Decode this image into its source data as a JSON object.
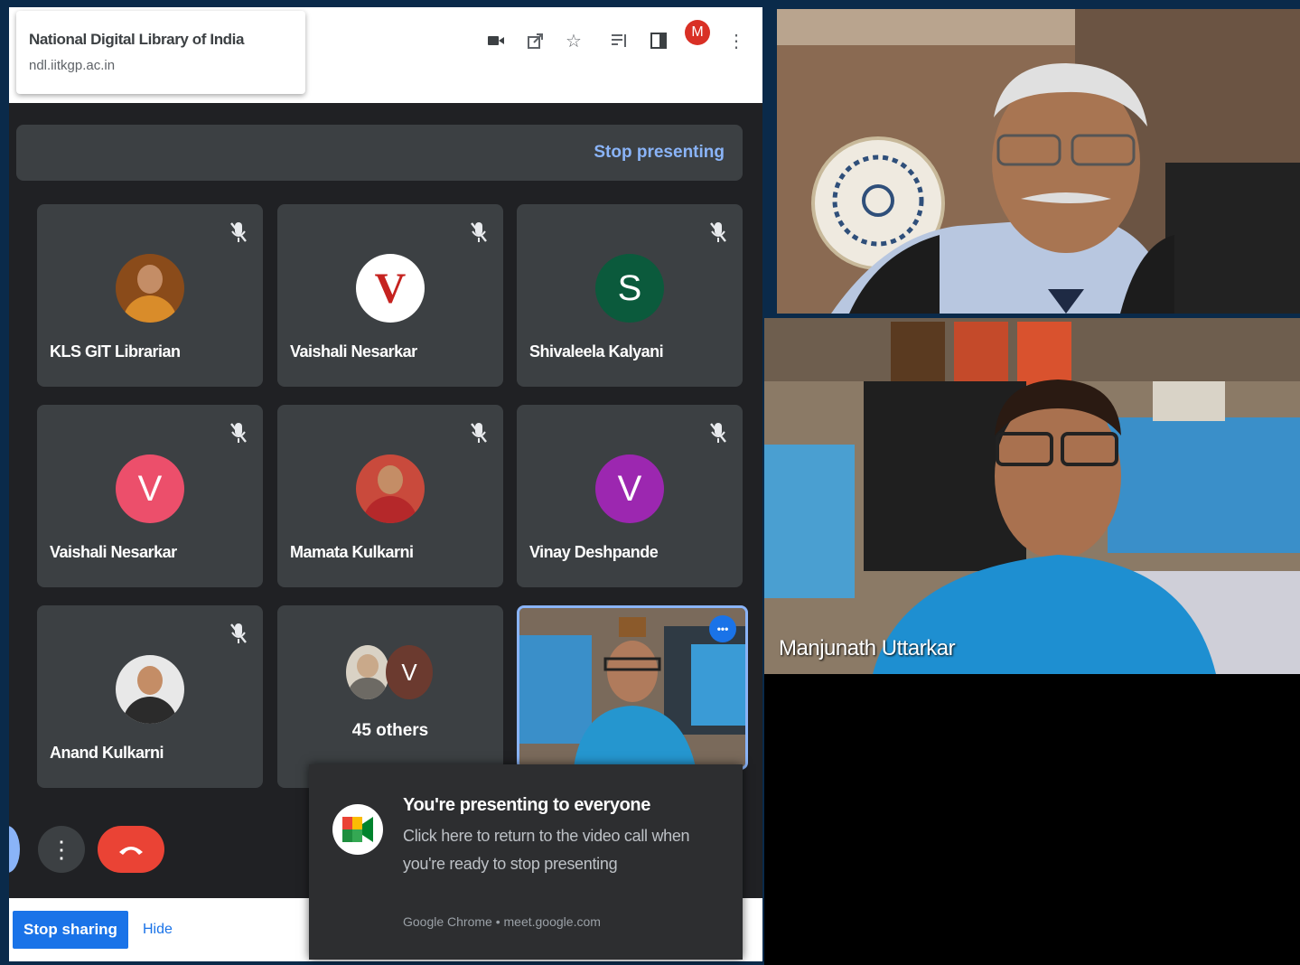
{
  "browser": {
    "tab_title": "National Digital Library of India",
    "tab_url": "ndl.iitkgp.ac.in",
    "profile_initial": "M",
    "toolbar_icons": [
      "camera-icon",
      "share-icon",
      "star-icon",
      "reading-list-icon",
      "sidebar-icon",
      "menu-icon"
    ]
  },
  "meet": {
    "stop_presenting_label": "Stop presenting",
    "participants": [
      {
        "name": "KLS GIT Librarian",
        "avatar_type": "photo",
        "avatar_color": "#8a4b1a",
        "muted": true
      },
      {
        "name": "Vaishali Nesarkar",
        "avatar_type": "letter",
        "avatar_letter": "V",
        "avatar_color": "#ffffff",
        "letter_color": "#c5221f",
        "muted": true
      },
      {
        "name": "Shivaleela Kalyani",
        "avatar_type": "letter",
        "avatar_letter": "S",
        "avatar_color": "#0b5a3c",
        "letter_color": "#ffffff",
        "muted": true
      },
      {
        "name": "Vaishali Nesarkar",
        "avatar_type": "letter",
        "avatar_letter": "V",
        "avatar_color": "#ec4f6b",
        "letter_color": "#ffffff",
        "muted": true
      },
      {
        "name": "Mamata Kulkarni",
        "avatar_type": "photo",
        "avatar_color": "#c94a3c",
        "muted": true
      },
      {
        "name": "Vinay Deshpande",
        "avatar_type": "letter",
        "avatar_letter": "V",
        "avatar_color": "#9c27b0",
        "letter_color": "#ffffff",
        "muted": true
      },
      {
        "name": "Anand Kulkarni",
        "avatar_type": "photo",
        "avatar_color": "#e8e8e8",
        "muted": true
      }
    ],
    "others": {
      "label": "45 others",
      "avatar_letter": "V",
      "avatar_color": "#6b3a2f"
    },
    "self_tile_more_label": "•••",
    "colors": {
      "hangup": "#ea4335",
      "accent": "#1a73e8",
      "tile": "#3c4043"
    }
  },
  "share_bar": {
    "stop_sharing_label": "Stop sharing",
    "hide_label": "Hide"
  },
  "notification": {
    "title": "You're presenting to everyone",
    "body": "Click here to return to the video call when you're ready to stop presenting",
    "source": "Google Chrome • meet.google.com"
  },
  "speakers": [
    {
      "name": ""
    },
    {
      "name": "Manjunath Uttarkar"
    }
  ]
}
